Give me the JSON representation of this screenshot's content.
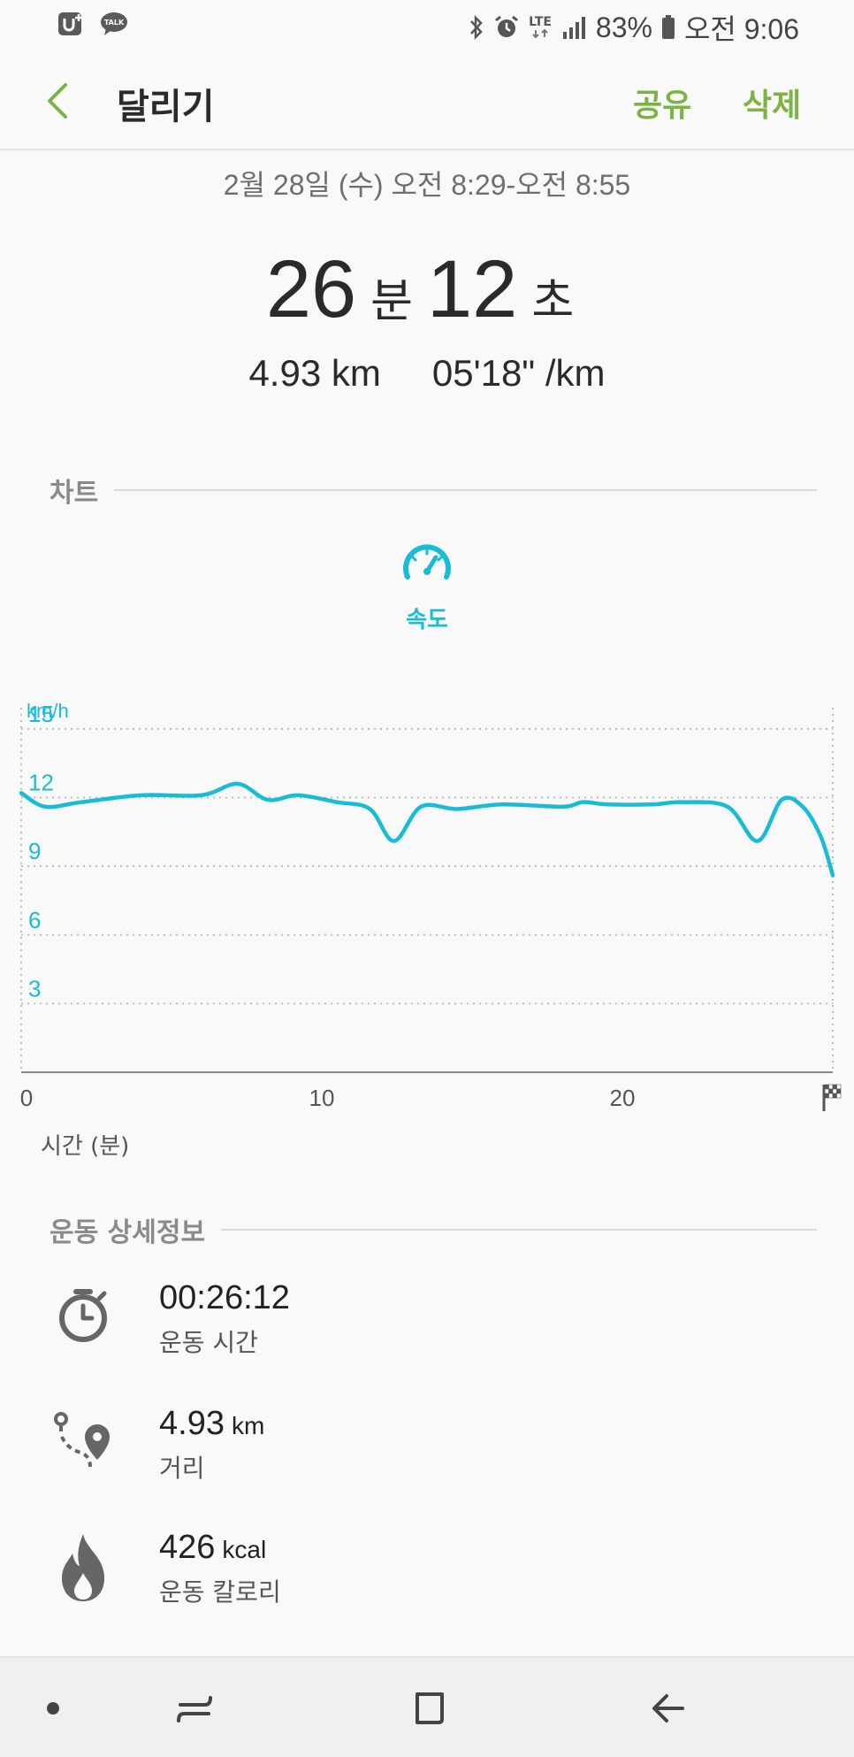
{
  "status_bar": {
    "left_icons": [
      "uplus-icon",
      "kakaotalk-icon"
    ],
    "kakao_label": "TALK",
    "network": "LTE",
    "battery_pct": "83%",
    "time": "오전 9:06"
  },
  "app_bar": {
    "title": "달리기",
    "share": "공유",
    "delete": "삭제"
  },
  "summary": {
    "date_range": "2월 28일 (수) 오전 8:29-오전 8:55",
    "minutes": "26",
    "minutes_unit": "분",
    "seconds": "12",
    "seconds_unit": "초",
    "distance": "4.93 km",
    "pace": "05'18\" /km"
  },
  "chart_section": {
    "title": "차트",
    "metric_label": "속도",
    "metric_icon": "speedometer-icon"
  },
  "colors": {
    "accent_green": "#7cb342",
    "chart_cyan": "#19bcd6"
  },
  "chart_data": {
    "type": "line",
    "title": "",
    "ylabel": "km/h",
    "xlabel": "시간 (분)",
    "ylim": [
      0,
      16
    ],
    "xlim": [
      0,
      27
    ],
    "y_ticks": [
      3,
      6,
      9,
      12,
      15
    ],
    "x_ticks": [
      0,
      10,
      20
    ],
    "grid": true,
    "end_marker": "checkered-flag-icon",
    "series": [
      {
        "x": [
          0,
          0.8,
          2,
          4,
          6,
          7.2,
          8.2,
          9.2,
          10.5,
          11.6,
          12.4,
          13.3,
          14.5,
          16,
          18,
          18.7,
          19.5,
          21,
          22,
          23.5,
          24.5,
          25.3,
          26,
          26.6,
          27
        ],
        "values": [
          12.2,
          11.6,
          11.8,
          12.1,
          12.1,
          12.6,
          11.9,
          12.1,
          11.8,
          11.5,
          10.1,
          11.6,
          11.5,
          11.7,
          11.6,
          11.8,
          11.7,
          11.7,
          11.8,
          11.6,
          10.1,
          11.9,
          11.6,
          10.3,
          8.6
        ]
      }
    ]
  },
  "details_section": {
    "title": "운동 상세정보",
    "items": [
      {
        "icon": "stopwatch-icon",
        "value": "00:26:12",
        "unit": "",
        "label": "운동 시간"
      },
      {
        "icon": "route-distance-icon",
        "value": "4.93",
        "unit": "km",
        "label": "거리"
      },
      {
        "icon": "flame-icon",
        "value": "426",
        "unit": "kcal",
        "label": "운동 칼로리"
      }
    ]
  },
  "nav_bar": {
    "items": [
      "dot-icon",
      "recent-apps-icon",
      "home-icon",
      "back-icon"
    ]
  }
}
